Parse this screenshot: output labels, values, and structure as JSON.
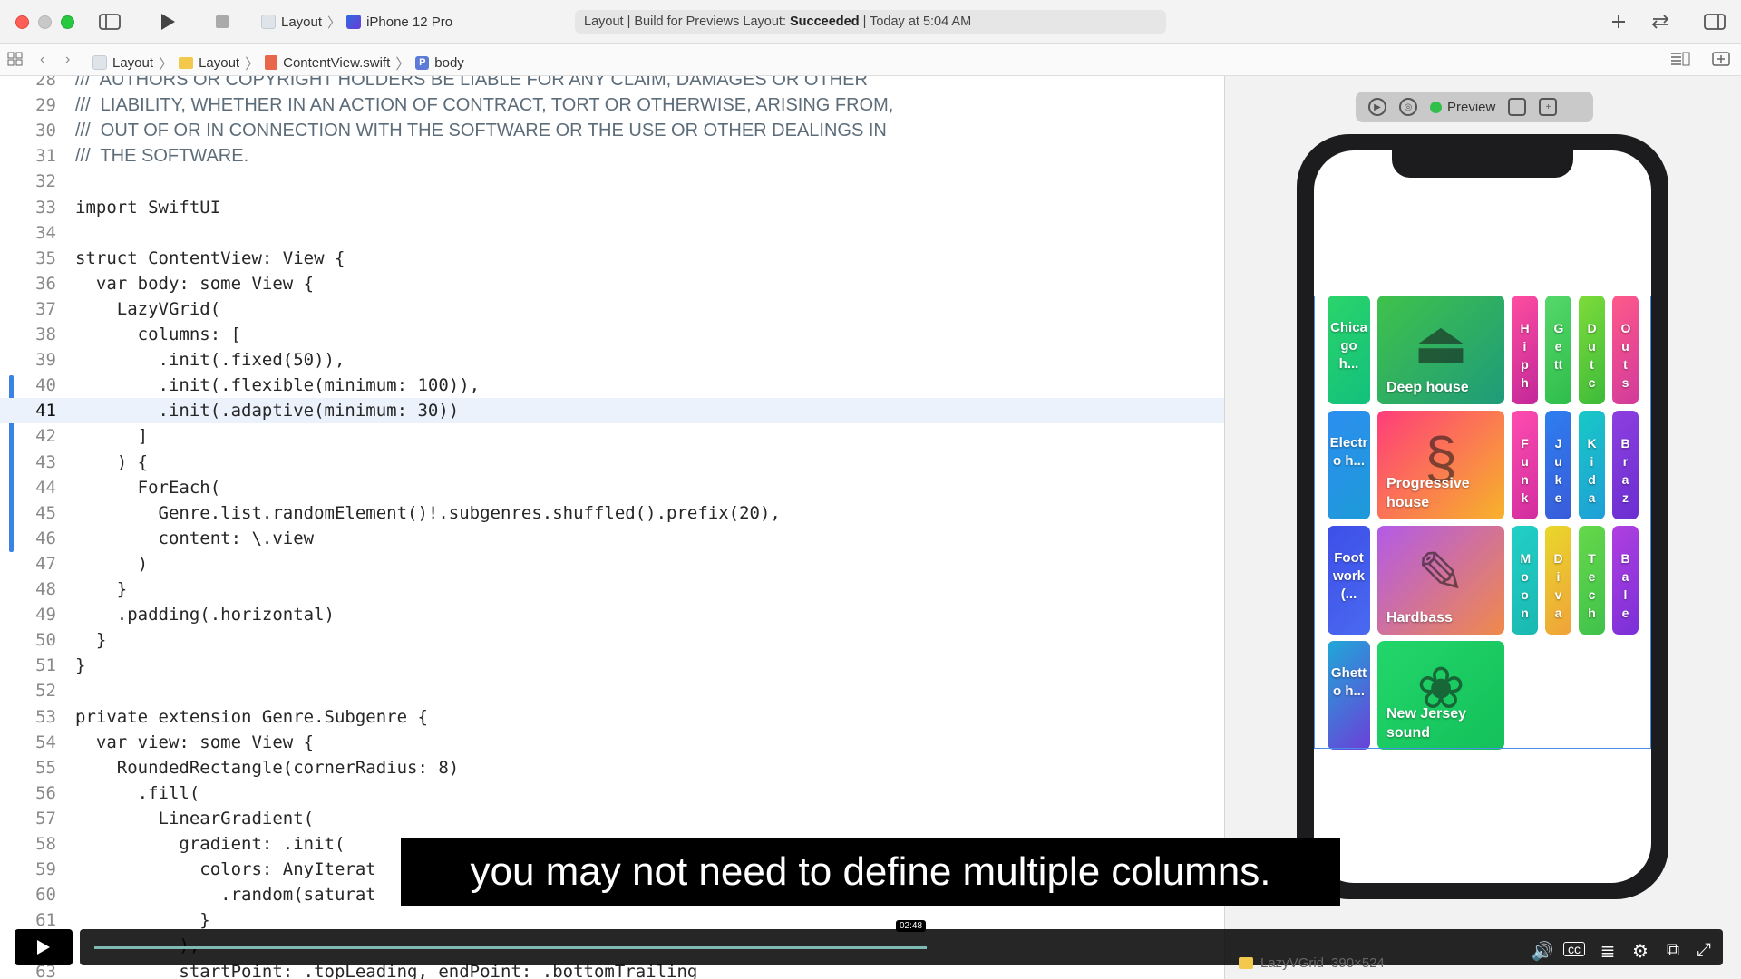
{
  "toolbar": {
    "scheme_project": "Layout",
    "scheme_device": "iPhone 12 Pro",
    "status_prefix": "Layout | Build for Previews Layout:",
    "status_result": "Succeeded",
    "status_time": "| Today at 5:04 AM"
  },
  "jumpbar": {
    "items": [
      "Layout",
      "Layout",
      "ContentView.swift",
      "body"
    ]
  },
  "editor": {
    "current_line": "41",
    "lines": [
      {
        "n": "28",
        "t": "///  AUTHORS OR COPYRIGHT HOLDERS BE LIABLE FOR ANY CLAIM, DAMAGES OR OTHER"
      },
      {
        "n": "29",
        "t": "///  LIABILITY, WHETHER IN AN ACTION OF CONTRACT, TORT OR OTHERWISE, ARISING FROM,"
      },
      {
        "n": "30",
        "t": "///  OUT OF OR IN CONNECTION WITH THE SOFTWARE OR THE USE OR OTHER DEALINGS IN"
      },
      {
        "n": "31",
        "t": "///  THE SOFTWARE."
      },
      {
        "n": "32",
        "t": ""
      },
      {
        "n": "33",
        "t": "import SwiftUI"
      },
      {
        "n": "34",
        "t": ""
      },
      {
        "n": "35",
        "t": "struct ContentView: View {"
      },
      {
        "n": "36",
        "t": "  var body: some View {"
      },
      {
        "n": "37",
        "t": "    LazyVGrid("
      },
      {
        "n": "38",
        "t": "      columns: ["
      },
      {
        "n": "39",
        "t": "        .init(.fixed(50)),"
      },
      {
        "n": "40",
        "t": "        .init(.flexible(minimum: 100)),"
      },
      {
        "n": "41",
        "t": "        .init(.adaptive(minimum: 30))"
      },
      {
        "n": "42",
        "t": "      ]"
      },
      {
        "n": "43",
        "t": "    ) {"
      },
      {
        "n": "44",
        "t": "      ForEach("
      },
      {
        "n": "45",
        "t": "        Genre.list.randomElement()!.subgenres.shuffled().prefix(20),"
      },
      {
        "n": "46",
        "t": "        content: \\.view"
      },
      {
        "n": "47",
        "t": "      )"
      },
      {
        "n": "48",
        "t": "    }"
      },
      {
        "n": "49",
        "t": "    .padding(.horizontal)"
      },
      {
        "n": "50",
        "t": "  }"
      },
      {
        "n": "51",
        "t": "}"
      },
      {
        "n": "52",
        "t": ""
      },
      {
        "n": "53",
        "t": "private extension Genre.Subgenre {"
      },
      {
        "n": "54",
        "t": "  var view: some View {"
      },
      {
        "n": "55",
        "t": "    RoundedRectangle(cornerRadius: 8)"
      },
      {
        "n": "56",
        "t": "      .fill("
      },
      {
        "n": "57",
        "t": "        LinearGradient("
      },
      {
        "n": "58",
        "t": "          gradient: .init("
      },
      {
        "n": "59",
        "t": "            colors: AnyIterat"
      },
      {
        "n": "60",
        "t": "              .random(saturat"
      },
      {
        "n": "61",
        "t": "            }"
      },
      {
        "n": "62",
        "t": "          ),"
      },
      {
        "n": "63",
        "t": "          startPoint: .topLeading, endPoint: .bottomTrailing"
      }
    ]
  },
  "preview": {
    "label": "Preview",
    "tiles": [
      {
        "text": "Chicago h...",
        "kind": "col1",
        "colors": [
          "#2bd46a",
          "#12c07c"
        ]
      },
      {
        "text": "Deep house",
        "kind": "big",
        "colors": [
          "#3fc24b",
          "#1f9b7a"
        ],
        "icon": "kettlebell-icon",
        "glyph": "⏏"
      },
      {
        "text": "Hiph",
        "kind": "col3",
        "colors": [
          "#ff4ea0",
          "#c2289a"
        ]
      },
      {
        "text": "Gett",
        "kind": "col3",
        "colors": [
          "#55d86a",
          "#2fbd4a"
        ]
      },
      {
        "text": "Dutc",
        "kind": "col3",
        "colors": [
          "#7ddc3a",
          "#3dbb3a"
        ]
      },
      {
        "text": "Outs",
        "kind": "col3",
        "colors": [
          "#ff5a8a",
          "#d13a9a"
        ]
      },
      {
        "text": "Electro h...",
        "kind": "col1",
        "colors": [
          "#2c8ef0",
          "#1e9ad8"
        ]
      },
      {
        "text": "Progressive house",
        "kind": "big",
        "colors": [
          "#ff3d7a",
          "#f7b32b"
        ],
        "icon": "snake-icon",
        "glyph": "§"
      },
      {
        "text": "Funk",
        "kind": "col3",
        "colors": [
          "#ff4db0",
          "#d12d9e"
        ]
      },
      {
        "text": "Juke",
        "kind": "col3",
        "colors": [
          "#2d7ff0",
          "#3a5bd9"
        ]
      },
      {
        "text": "Kida",
        "kind": "col3",
        "colors": [
          "#18c9c6",
          "#1f9ed8"
        ]
      },
      {
        "text": "Braz",
        "kind": "col3",
        "colors": [
          "#8e3fe0",
          "#6a2fd0"
        ]
      },
      {
        "text": "Footwork (...",
        "kind": "col1",
        "colors": [
          "#3d4ee8",
          "#4a6af0"
        ]
      },
      {
        "text": "Hardbass",
        "kind": "big",
        "colors": [
          "#b25ae8",
          "#f08a4a"
        ],
        "icon": "menu-card-icon",
        "glyph": "✎"
      },
      {
        "text": "Moon",
        "kind": "col3",
        "colors": [
          "#22d0c8",
          "#1ab8b0"
        ]
      },
      {
        "text": "Diva",
        "kind": "col3",
        "colors": [
          "#e8d82a",
          "#f0a23a"
        ]
      },
      {
        "text": "Tech",
        "kind": "col3",
        "colors": [
          "#66d84a",
          "#3fc24b"
        ]
      },
      {
        "text": "Bale",
        "kind": "col3",
        "colors": [
          "#b040e0",
          "#7a2fd8"
        ]
      },
      {
        "text": "Ghetto h...",
        "kind": "col1",
        "colors": [
          "#1fa8d8",
          "#6b3fd8"
        ]
      },
      {
        "text": "New Jersey sound",
        "kind": "big",
        "colors": [
          "#22d66a",
          "#14c05a"
        ],
        "icon": "sleeping-cat-icon",
        "glyph": "❀"
      }
    ]
  },
  "video": {
    "subtitle": "you may not need to define multiple columns.",
    "time": "02:48",
    "progress": 0.51
  },
  "bottom_status": {
    "label": "LazyVGrid",
    "size": "390×524"
  }
}
